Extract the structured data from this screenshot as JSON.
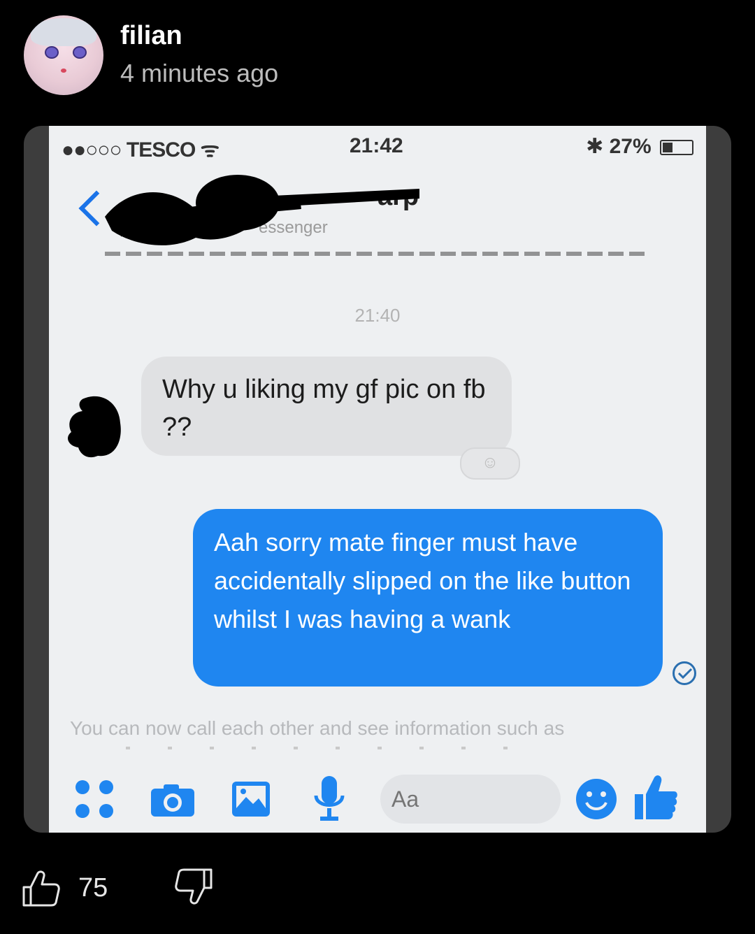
{
  "post": {
    "author": "filian",
    "time": "4 minutes ago"
  },
  "screenshot": {
    "status_bar": {
      "carrier": "●●○○○ TESCO ᯤ",
      "time": "21:42",
      "battery": "27%"
    },
    "chat": {
      "contact_name_fragment": "arp",
      "contact_subtitle_fragment": "essenger",
      "timestamp": "21:40",
      "incoming_message": "Why u liking my gf pic on fb ??",
      "outgoing_message": "Aah sorry mate finger must have accidentally slipped on the like button whilst I was having a wank",
      "info_text": "You can now call each other and see information such as",
      "composer_placeholder": "Aa"
    }
  },
  "actions": {
    "like_count": "75"
  },
  "colors": {
    "background": "#000000",
    "card": "#3d3d3d",
    "messenger_blue": "#1f86f0"
  },
  "icons": {
    "back": "chevron-left-icon",
    "apps": "grid-icon",
    "camera": "camera-icon",
    "image": "image-icon",
    "mic": "microphone-icon",
    "emoji": "emoji-icon",
    "like": "thumbs-up-icon",
    "upvote": "thumbs-up-outline-icon",
    "downvote": "thumbs-down-outline-icon"
  }
}
